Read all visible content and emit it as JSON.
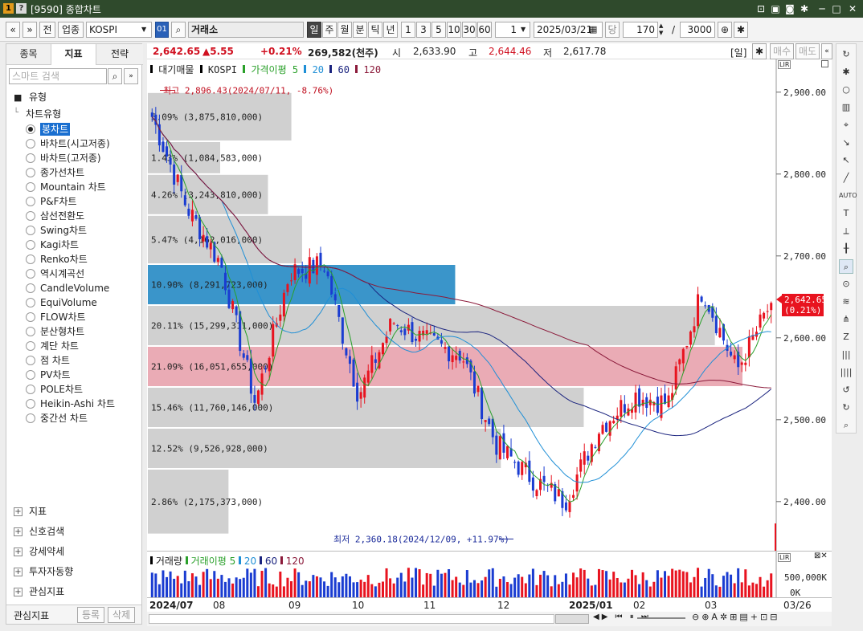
{
  "window": {
    "title": "[9590] 종합차트",
    "badge1": "1",
    "badge2": "?"
  },
  "toolbar": {
    "back": "«",
    "down": "»",
    "prev_label": "전",
    "sector_label": "업종",
    "symbol": "KOSPI",
    "code_btn": "01",
    "market": "거래소",
    "periods": [
      "일",
      "주",
      "월",
      "분",
      "틱",
      "년"
    ],
    "minutes": [
      "1",
      "3",
      "5",
      "10",
      "30",
      "60"
    ],
    "count_select": "1",
    "date": "2025/03/21",
    "dang": "당",
    "bars": "170",
    "slash": "/",
    "total": "3000"
  },
  "left_panel": {
    "tabs": [
      "종목",
      "지표",
      "전략"
    ],
    "search_placeholder": "스마트 검색",
    "section": "유형",
    "subsection": "차트유형",
    "chart_types": [
      "봉차트",
      "바차트(시고저종)",
      "바차트(고저종)",
      "종가선차트",
      "Mountain 차트",
      "P&F차트",
      "삼선전환도",
      "Swing차트",
      "Kagi차트",
      "Renko차트",
      "역시계곡선",
      "CandleVolume",
      "EquiVolume",
      "FLOW차트",
      "분산형차트",
      "계단 차트",
      "점 차트",
      "PV차트",
      "POLE차트",
      "Heikin-Ashi 차트",
      "중간선 차트"
    ],
    "groups": [
      "지표",
      "신호검색",
      "강세약세",
      "투자자동향",
      "관심지표"
    ],
    "footer_label": "관심지표",
    "register_btn": "등록",
    "delete_btn": "삭제"
  },
  "info": {
    "price": "2,642.65",
    "change": "▲5.55",
    "pct": "+0.21%",
    "volume": "269,582(천주)",
    "open_label": "시",
    "open": "2,633.90",
    "high_label": "고",
    "high": "2,644.46",
    "low_label": "저",
    "low": "2,617.78",
    "period_tag": "[일]",
    "buy": "매수",
    "sell": "매도"
  },
  "legend": {
    "items": [
      "대기매물",
      "KOSPI",
      "가격이평 5",
      "20",
      "60",
      "120"
    ],
    "colors": [
      "#000000",
      "#000000",
      "#2aa02a",
      "#1f8fd6",
      "#1a237e",
      "#8b1a3a"
    ]
  },
  "annotations": {
    "high": "최고 2,896.43(2024/07/11, -8.76%)",
    "low": "최저 2,360.18(2024/12/09, +11.97%)",
    "current_price": "2,642.65",
    "current_pct": "(0.21%)"
  },
  "profile_labels": [
    "5.09% (3,875,810,000)",
    "1.43% (1,084,583,000)",
    "4.26% (3,243,810,000)",
    "5.47% (4,162,016,000)",
    "10.90% (8,291,723,000)",
    "20.11% (15,299,311,000)",
    "21.09% (16,051,655,000)",
    "15.46% (11,760,146,000)",
    "12.52% (9,526,928,000)",
    "2.86% (2,175,373,000)"
  ],
  "y_axis": {
    "ticks": [
      "2,900.00",
      "2,800.00",
      "2,700.00",
      "2,600.00",
      "2,500.00",
      "2,400.00"
    ]
  },
  "volume_panel": {
    "legend": [
      "거래량",
      "거래이평 5",
      "20",
      "60",
      "120"
    ],
    "ticks": [
      "500,000K",
      "0K"
    ]
  },
  "x_axis": {
    "labels": [
      "2024/07",
      "08",
      "09",
      "10",
      "11",
      "12",
      "2025/01",
      "02",
      "03"
    ],
    "right_label": "03/26"
  },
  "colors": {
    "up": "#e8131f",
    "down": "#1a3cd1",
    "titlebar": "#2f4a2c",
    "pink_band": "#e8a2ad",
    "blue_band": "#2f8fc7",
    "gray_band": "#c8c8c8"
  },
  "chart_data": {
    "type": "candlestick",
    "symbol": "KOSPI",
    "period": "daily",
    "ylim": [
      2340,
      2940
    ],
    "x_range": [
      "2024/07",
      "2025/03/26"
    ],
    "last": {
      "open": 2633.9,
      "high": 2644.46,
      "low": 2617.78,
      "close": 2642.65,
      "change": 5.55,
      "pct": 0.21
    },
    "all_time_marks": {
      "high": {
        "value": 2896.43,
        "date": "2024/07/11"
      },
      "low": {
        "value": 2360.18,
        "date": "2024/12/09"
      }
    },
    "monthly_path": [
      {
        "x": "2024/07",
        "close": 2870
      },
      {
        "x": "2024/07b",
        "close": 2760
      },
      {
        "x": "08",
        "close": 2690
      },
      {
        "x": "08b",
        "close": 2520
      },
      {
        "x": "08c",
        "close": 2680
      },
      {
        "x": "09",
        "close": 2690
      },
      {
        "x": "09b",
        "close": 2530
      },
      {
        "x": "10",
        "close": 2620
      },
      {
        "x": "10b",
        "close": 2595
      },
      {
        "x": "11",
        "close": 2580
      },
      {
        "x": "11b",
        "close": 2470
      },
      {
        "x": "12",
        "close": 2430
      },
      {
        "x": "12b",
        "close": 2400
      },
      {
        "x": "2025/01",
        "close": 2490
      },
      {
        "x": "01b",
        "close": 2530
      },
      {
        "x": "02",
        "close": 2520
      },
      {
        "x": "02b",
        "close": 2660
      },
      {
        "x": "03",
        "close": 2560
      },
      {
        "x": "03b",
        "close": 2642.65
      }
    ],
    "volume_profile": [
      {
        "price_from": 2840,
        "price_to": 2900,
        "pct": 5.09
      },
      {
        "price_from": 2800,
        "price_to": 2840,
        "pct": 1.43
      },
      {
        "price_from": 2750,
        "price_to": 2800,
        "pct": 4.26
      },
      {
        "price_from": 2690,
        "price_to": 2750,
        "pct": 5.47
      },
      {
        "price_from": 2640,
        "price_to": 2690,
        "pct": 10.9
      },
      {
        "price_from": 2590,
        "price_to": 2640,
        "pct": 20.11
      },
      {
        "price_from": 2540,
        "price_to": 2590,
        "pct": 21.09
      },
      {
        "price_from": 2490,
        "price_to": 2540,
        "pct": 15.46
      },
      {
        "price_from": 2440,
        "price_to": 2490,
        "pct": 12.52
      },
      {
        "price_from": 2360,
        "price_to": 2440,
        "pct": 2.86
      }
    ]
  }
}
